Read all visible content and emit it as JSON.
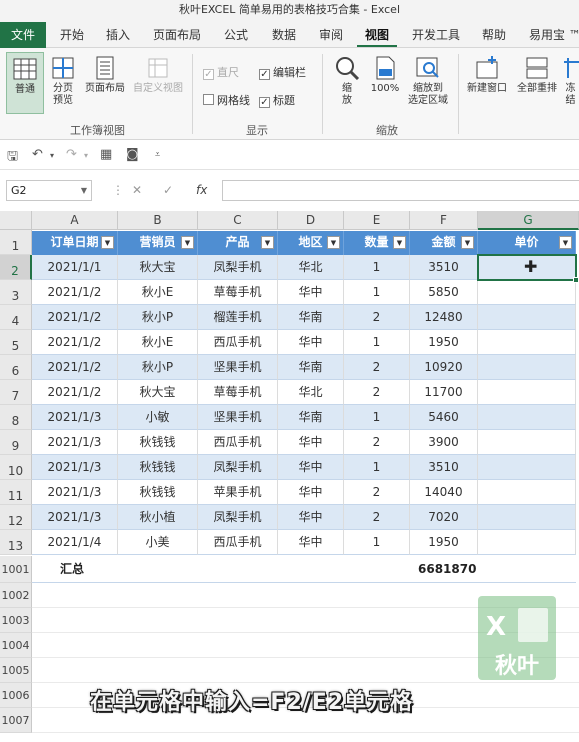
{
  "window": {
    "title": "秋叶EXCEL 简单易用的表格技巧合集  -  Excel"
  },
  "tabs": [
    "文件",
    "开始",
    "插入",
    "页面布局",
    "公式",
    "数据",
    "审阅",
    "视图",
    "开发工具",
    "帮助",
    "易用宝 ™"
  ],
  "active_tab": "视图",
  "ribbon": {
    "workbook_views": {
      "label": "工作簿视图",
      "normal": "普通",
      "page_break": "分页\n预览",
      "page_layout": "页面布局",
      "custom_view": "自定义视图"
    },
    "show": {
      "label": "显示",
      "ruler": "直尺",
      "formula_bar": "编辑栏",
      "gridlines": "网格线",
      "headings": "标题"
    },
    "zoom": {
      "label": "缩放",
      "zoom": "缩\n放",
      "zoom100": "100%",
      "zoom_selection": "缩放到\n选定区域"
    },
    "window": {
      "new_window": "新建窗口",
      "arrange_all": "全部重排",
      "freeze": "冻结"
    }
  },
  "formula_bar": {
    "name_box": "G2",
    "fx": "fx",
    "value": ""
  },
  "columns": [
    "A",
    "B",
    "C",
    "D",
    "E",
    "F",
    "G"
  ],
  "selected_column": "G",
  "table": {
    "headers": [
      "订单日期",
      "营销员",
      "产品",
      "地区",
      "数量",
      "金额",
      "单价"
    ],
    "rows": [
      {
        "n": "2",
        "c": [
          "2021/1/1",
          "秋大宝",
          "凤梨手机",
          "华北",
          "1",
          "3510",
          ""
        ]
      },
      {
        "n": "3",
        "c": [
          "2021/1/2",
          "秋小E",
          "草莓手机",
          "华中",
          "1",
          "5850",
          ""
        ]
      },
      {
        "n": "4",
        "c": [
          "2021/1/2",
          "秋小P",
          "榴莲手机",
          "华南",
          "2",
          "12480",
          ""
        ]
      },
      {
        "n": "5",
        "c": [
          "2021/1/2",
          "秋小E",
          "西瓜手机",
          "华中",
          "1",
          "1950",
          ""
        ]
      },
      {
        "n": "6",
        "c": [
          "2021/1/2",
          "秋小P",
          "坚果手机",
          "华南",
          "2",
          "10920",
          ""
        ]
      },
      {
        "n": "7",
        "c": [
          "2021/1/2",
          "秋大宝",
          "草莓手机",
          "华北",
          "2",
          "11700",
          ""
        ]
      },
      {
        "n": "8",
        "c": [
          "2021/1/3",
          "小敏",
          "坚果手机",
          "华南",
          "1",
          "5460",
          ""
        ]
      },
      {
        "n": "9",
        "c": [
          "2021/1/3",
          "秋钱钱",
          "西瓜手机",
          "华中",
          "2",
          "3900",
          ""
        ]
      },
      {
        "n": "10",
        "c": [
          "2021/1/3",
          "秋钱钱",
          "凤梨手机",
          "华中",
          "1",
          "3510",
          ""
        ]
      },
      {
        "n": "11",
        "c": [
          "2021/1/3",
          "秋钱钱",
          "苹果手机",
          "华中",
          "2",
          "14040",
          ""
        ]
      },
      {
        "n": "12",
        "c": [
          "2021/1/3",
          "秋小植",
          "凤梨手机",
          "华中",
          "2",
          "7020",
          ""
        ]
      },
      {
        "n": "13",
        "c": [
          "2021/1/4",
          "小美",
          "西瓜手机",
          "华中",
          "1",
          "1950",
          ""
        ]
      }
    ],
    "header_row_num": "1",
    "total": {
      "row_num": "1001",
      "label": "汇总",
      "value": "6681870"
    },
    "empty_rows": [
      "1002",
      "1003",
      "1004",
      "1005",
      "1006",
      "1007"
    ]
  },
  "subtitle": "在单元格中输入=F2/E2单元格",
  "watermark": {
    "logo_text": "秋叶",
    "logo_letter": "X"
  },
  "colors": {
    "accent": "#217346",
    "header_fill": "#4f8ed2",
    "band_fill": "#dce8f5"
  }
}
